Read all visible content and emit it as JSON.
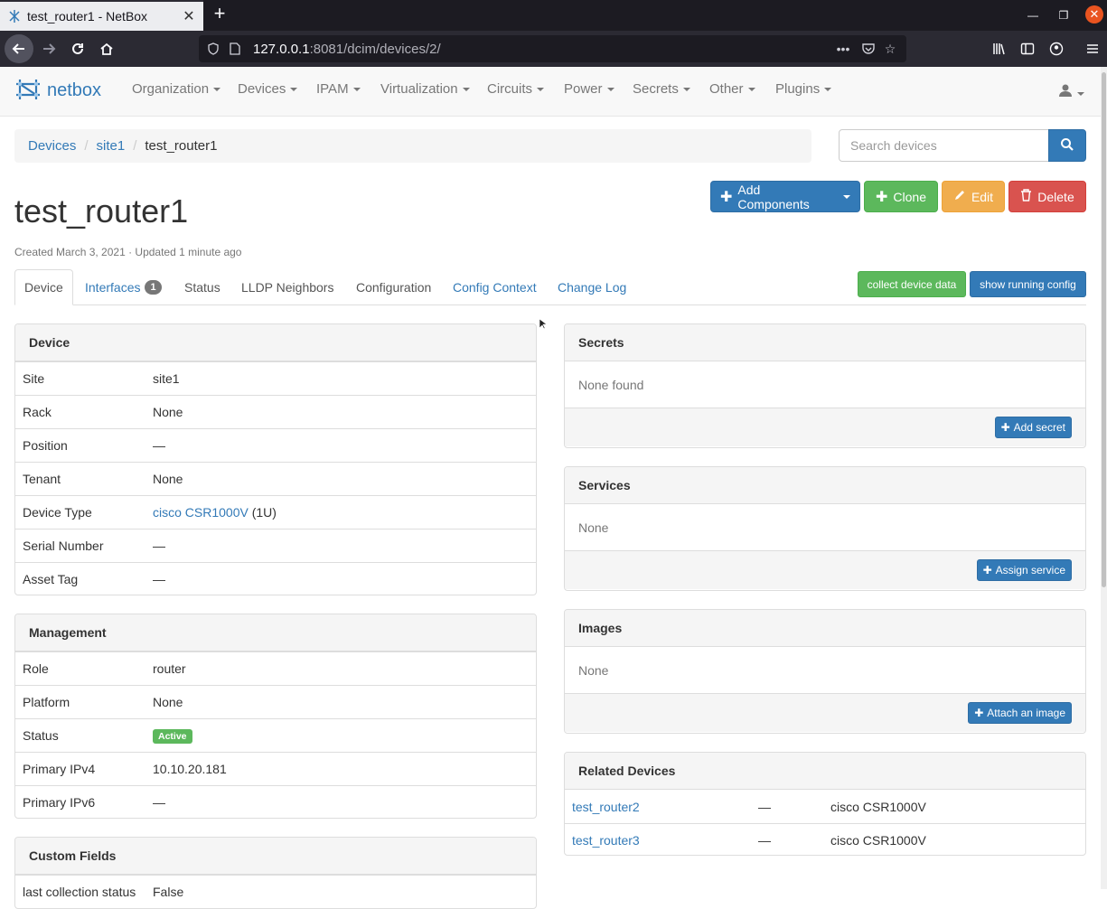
{
  "browser": {
    "tab_title": "test_router1 - NetBox",
    "url_host": "127.0.0.1",
    "url_path": ":8081/dcim/devices/2/",
    "icons": [
      "back-icon",
      "forward-icon",
      "reload-icon",
      "home-icon",
      "shield-icon",
      "page-icon",
      "more-icon",
      "pocket-icon",
      "star-icon",
      "library-icon",
      "sidebar-icon",
      "account-icon",
      "menu-icon"
    ]
  },
  "nav": {
    "brand": "netbox",
    "menus": [
      "Organization",
      "Devices",
      "IPAM",
      "Virtualization",
      "Circuits",
      "Power",
      "Secrets",
      "Other",
      "Plugins"
    ]
  },
  "breadcrumb": {
    "items": [
      "Devices",
      "site1"
    ],
    "current": "test_router1"
  },
  "search": {
    "placeholder": "Search devices"
  },
  "page": {
    "title": "test_router1",
    "meta": "Created March 3, 2021 · Updated 1 minute ago"
  },
  "actions": {
    "add_components": "Add Components",
    "clone": "Clone",
    "edit": "Edit",
    "delete": "Delete"
  },
  "tabs": {
    "device": "Device",
    "interfaces": "Interfaces",
    "interfaces_count": "1",
    "status": "Status",
    "lldp": "LLDP Neighbors",
    "configuration": "Configuration",
    "config_context": "Config Context",
    "change_log": "Change Log"
  },
  "plugin_buttons": {
    "collect": "collect device data",
    "show_running": "show running config"
  },
  "device_panel": {
    "title": "Device",
    "site_label": "Site",
    "site": "site1",
    "rack_label": "Rack",
    "rack": "None",
    "position_label": "Position",
    "position": "—",
    "tenant_label": "Tenant",
    "tenant": "None",
    "device_type_label": "Device Type",
    "device_type": "cisco CSR1000V",
    "device_type_u": "(1U)",
    "serial_label": "Serial Number",
    "serial": "—",
    "asset_label": "Asset Tag",
    "asset": "—"
  },
  "management_panel": {
    "title": "Management",
    "role_label": "Role",
    "role": "router",
    "platform_label": "Platform",
    "platform": "None",
    "status_label": "Status",
    "status": "Active",
    "ipv4_label": "Primary IPv4",
    "ipv4": "10.10.20.181",
    "ipv6_label": "Primary IPv6",
    "ipv6": "—"
  },
  "custom_fields_panel": {
    "title": "Custom Fields",
    "row_label": "last collection status",
    "row_value": "False"
  },
  "secrets_panel": {
    "title": "Secrets",
    "body": "None found",
    "button": "Add secret"
  },
  "services_panel": {
    "title": "Services",
    "body": "None",
    "button": "Assign service"
  },
  "images_panel": {
    "title": "Images",
    "body": "None",
    "button": "Attach an image"
  },
  "related_panel": {
    "title": "Related Devices",
    "rows": [
      {
        "name": "test_router2",
        "dash": "—",
        "type": "cisco CSR1000V"
      },
      {
        "name": "test_router3",
        "dash": "—",
        "type": "cisco CSR1000V"
      }
    ]
  },
  "colors": {
    "primary": "#337ab7",
    "success": "#5cb85c",
    "warning": "#f0ad4e",
    "danger": "#d9534f"
  }
}
